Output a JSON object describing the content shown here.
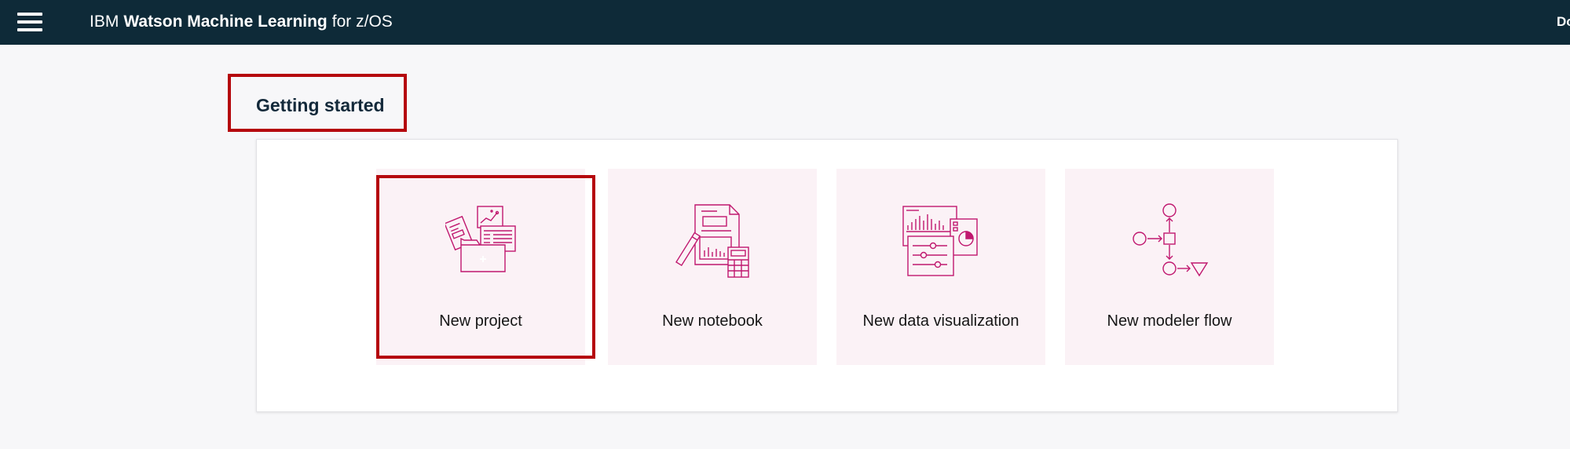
{
  "topbar": {
    "menu_icon": "hamburger-menu-icon",
    "brand_prefix": "IBM",
    "brand_product": "Watson Machine Learning",
    "brand_suffix": "for z/OS",
    "right_text": "Do"
  },
  "main": {
    "title": "Getting started",
    "tiles": [
      {
        "label": "New project",
        "icon": "project-icon"
      },
      {
        "label": "New notebook",
        "icon": "notebook-icon"
      },
      {
        "label": "New data visualization",
        "icon": "data-visualization-icon"
      },
      {
        "label": "New modeler flow",
        "icon": "modeler-flow-icon"
      }
    ]
  },
  "colors": {
    "topbar_bg": "#0e2a38",
    "page_bg": "#f7f7f9",
    "tile_bg": "#fbf2f6",
    "icon_stroke": "#c0186f",
    "highlight": "#b5080d"
  }
}
